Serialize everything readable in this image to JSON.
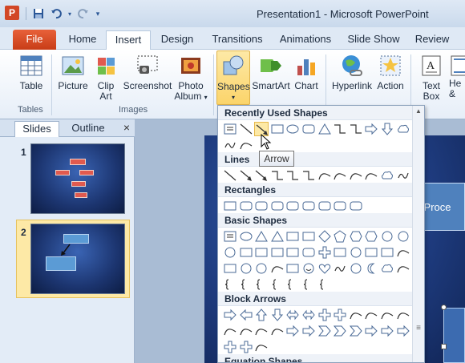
{
  "window": {
    "title": "Presentation1 - Microsoft PowerPoint",
    "app_icon_letter": "P"
  },
  "tabs": [
    {
      "label": "File"
    },
    {
      "label": "Home"
    },
    {
      "label": "Insert"
    },
    {
      "label": "Design"
    },
    {
      "label": "Transitions"
    },
    {
      "label": "Animations"
    },
    {
      "label": "Slide Show"
    },
    {
      "label": "Review"
    }
  ],
  "ribbon": {
    "table": "Table",
    "picture": "Picture",
    "clip_art_l1": "Clip",
    "clip_art_l2": "Art",
    "screenshot": "Screenshot",
    "photo_album_l1": "Photo",
    "photo_album_l2": "Album",
    "shapes": "Shapes",
    "smartart": "SmartArt",
    "chart": "Chart",
    "hyperlink": "Hyperlink",
    "action": "Action",
    "text_box_l1": "Text",
    "text_box_l2": "Box",
    "header_partial_l1": "He",
    "header_partial_l2": "&",
    "group_tables": "Tables",
    "group_images": "Images"
  },
  "panel": {
    "tab_slides": "Slides",
    "tab_outline": "Outline",
    "close": "×",
    "slide1_num": "1",
    "slide2_num": "2"
  },
  "slide": {
    "box_text": "rt Proce"
  },
  "dropdown": {
    "recently_used": "Recently Used Shapes",
    "lines": "Lines",
    "rectangles": "Rectangles",
    "basic_shapes": "Basic Shapes",
    "block_arrows": "Block Arrows",
    "equation_shapes": "Equation Shapes",
    "tooltip": "Arrow"
  },
  "colors": {
    "accent": "#d24726",
    "ribbon_highlight": "#fbd46a",
    "slide_bg": "#1e3b7e"
  }
}
